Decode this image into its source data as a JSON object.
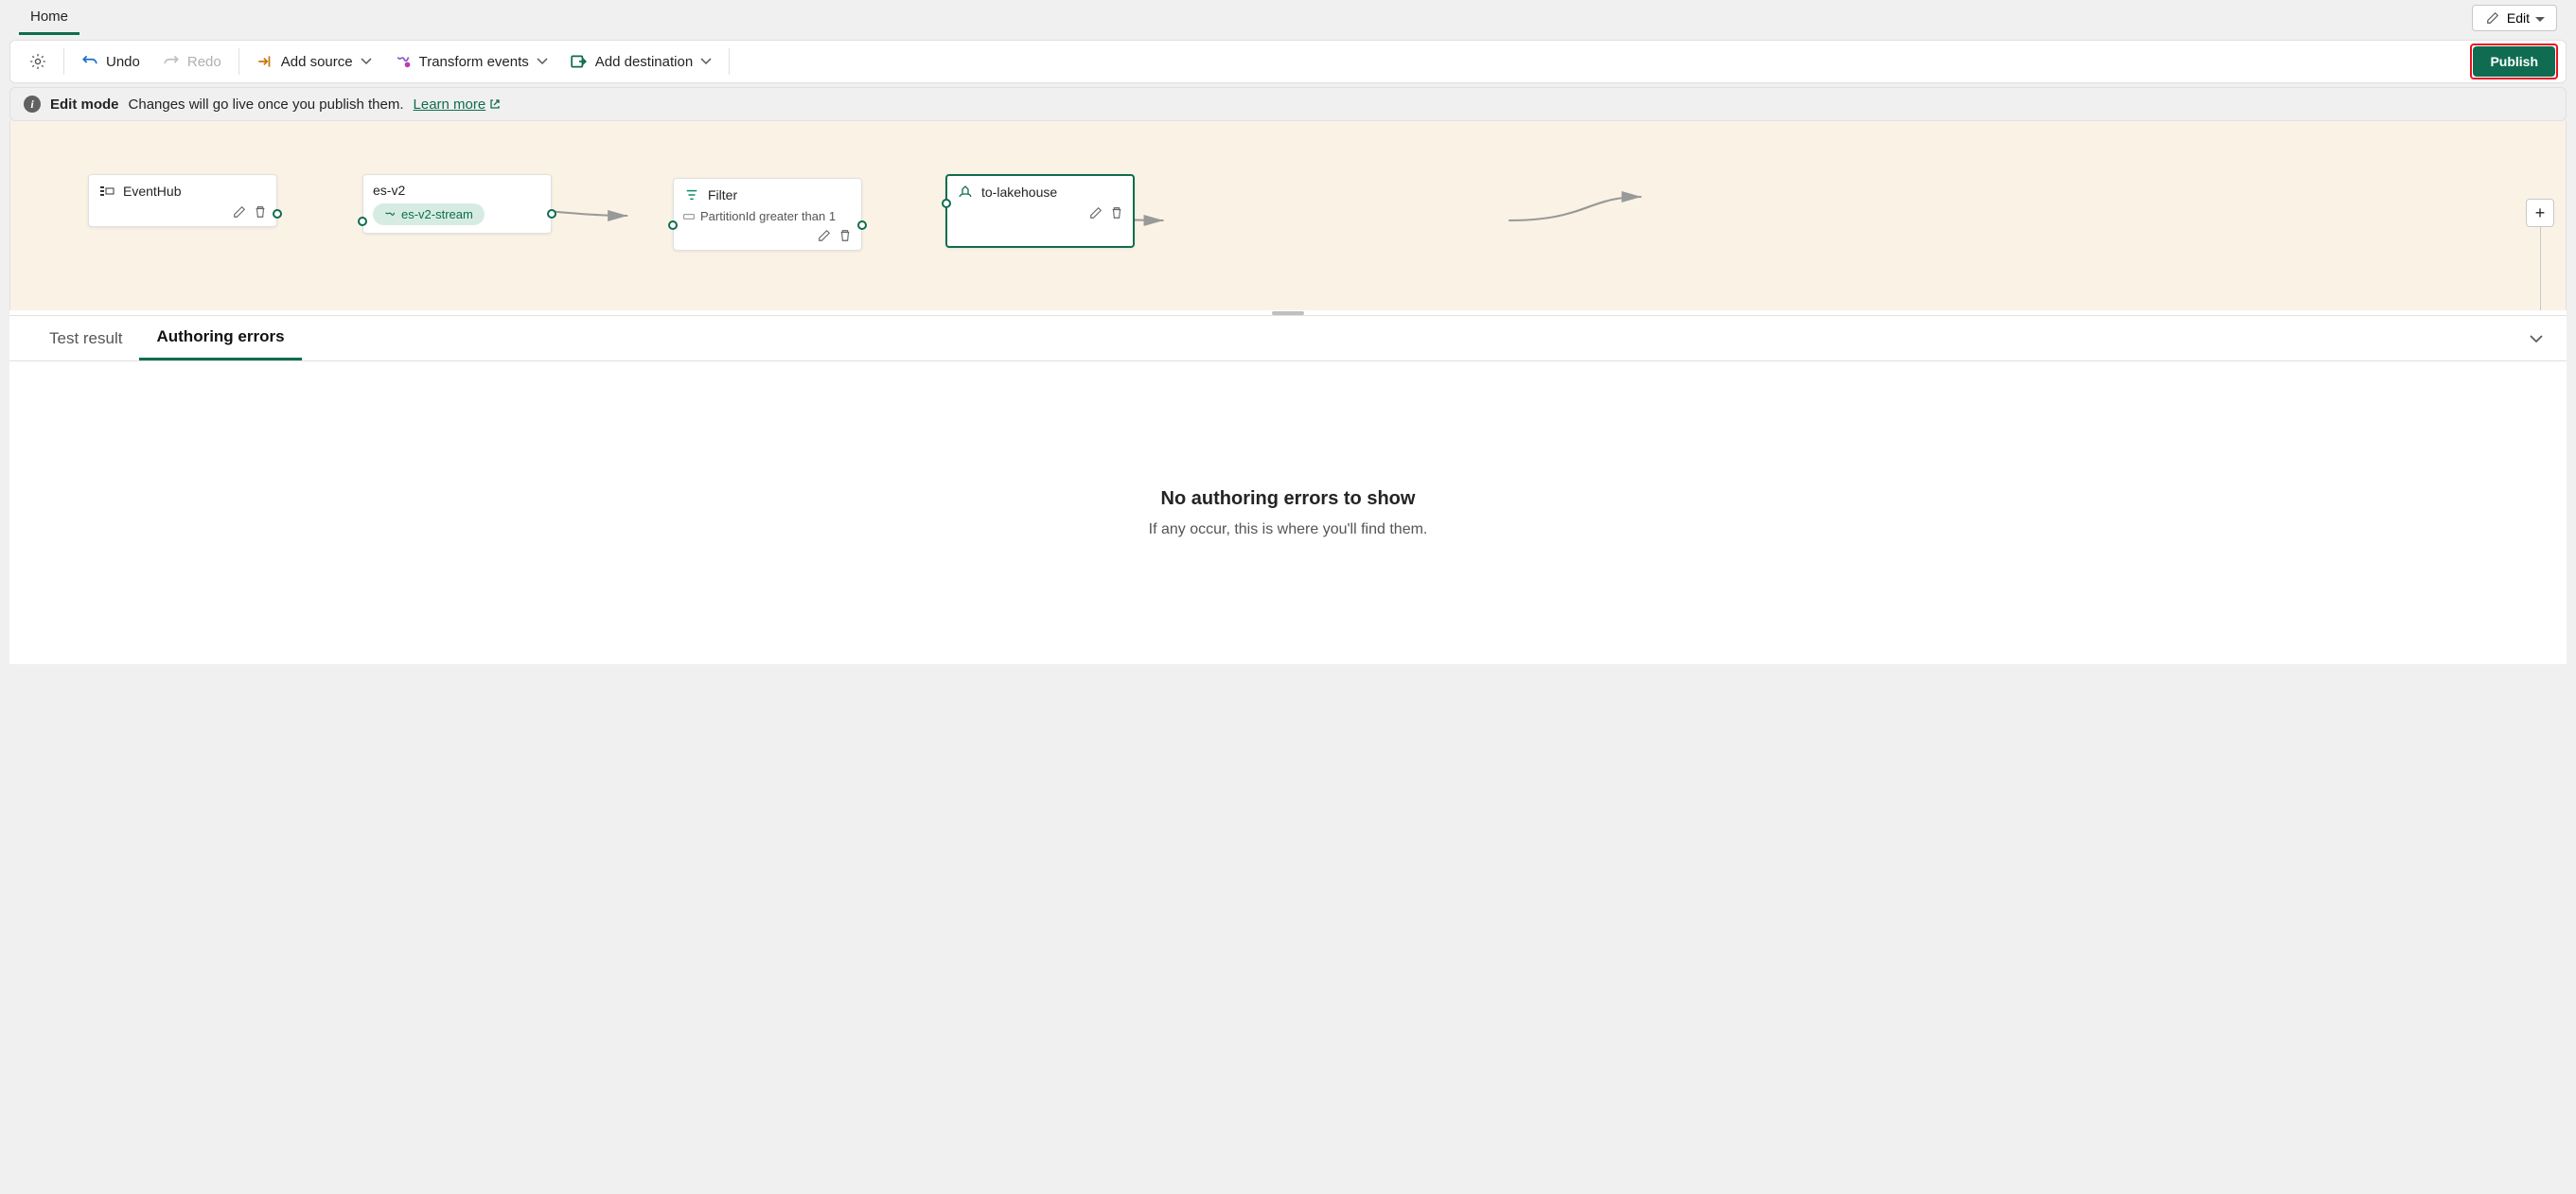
{
  "ribbon": {
    "active_tab": "Home",
    "edit_label": "Edit"
  },
  "toolbar": {
    "undo": "Undo",
    "redo": "Redo",
    "add_source": "Add source",
    "transform": "Transform events",
    "add_destination": "Add destination",
    "publish": "Publish"
  },
  "infobar": {
    "title": "Edit mode",
    "message": "Changes will go live once you publish them.",
    "learn_more": "Learn more"
  },
  "canvas": {
    "nodes": {
      "source": {
        "icon": "eventhub-icon",
        "label": "EventHub"
      },
      "stream": {
        "label": "es-v2",
        "pill": "es-v2-stream"
      },
      "filter": {
        "label": "Filter",
        "condition": "PartitionId greater than 1"
      },
      "dest": {
        "label": "to-lakehouse"
      }
    }
  },
  "bottom_tabs": {
    "test_result": "Test result",
    "authoring_errors": "Authoring errors"
  },
  "empty_state": {
    "title": "No authoring errors to show",
    "subtitle": "If any occur, this is where you'll find them."
  }
}
